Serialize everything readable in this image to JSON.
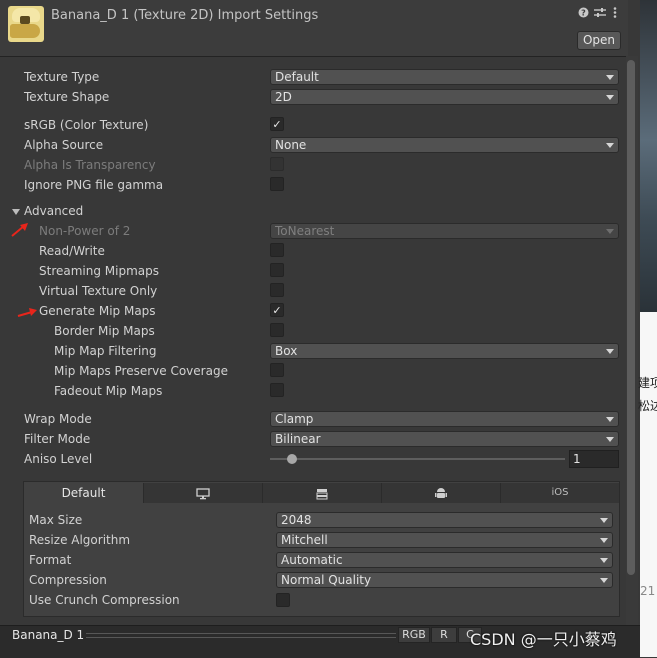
{
  "header": {
    "title": "Banana_D 1 (Texture 2D) Import Settings",
    "icons": [
      "help-icon",
      "sliders-icon",
      "more-icon"
    ],
    "open_label": "Open"
  },
  "settings": {
    "texture_type": {
      "label": "Texture Type",
      "value": "Default"
    },
    "texture_shape": {
      "label": "Texture Shape",
      "value": "2D"
    },
    "srgb": {
      "label": "sRGB (Color Texture)",
      "checked": true
    },
    "alpha_source": {
      "label": "Alpha Source",
      "value": "None"
    },
    "alpha_is_transparency": {
      "label": "Alpha Is Transparency",
      "checked": false
    },
    "ignore_png_gamma": {
      "label": "Ignore PNG file gamma",
      "checked": false
    },
    "advanced": {
      "label": "Advanced"
    },
    "non_power_of_2": {
      "label": "Non-Power of 2",
      "value": "ToNearest"
    },
    "read_write": {
      "label": "Read/Write",
      "checked": false
    },
    "streaming_mipmaps": {
      "label": "Streaming Mipmaps",
      "checked": false
    },
    "virtual_texture_only": {
      "label": "Virtual Texture Only",
      "checked": false
    },
    "generate_mip_maps": {
      "label": "Generate Mip Maps",
      "checked": true
    },
    "border_mip_maps": {
      "label": "Border Mip Maps",
      "checked": false
    },
    "mip_map_filtering": {
      "label": "Mip Map Filtering",
      "value": "Box"
    },
    "mip_maps_preserve_coverage": {
      "label": "Mip Maps Preserve Coverage",
      "checked": false
    },
    "fadeout_mip_maps": {
      "label": "Fadeout Mip Maps",
      "checked": false
    },
    "wrap_mode": {
      "label": "Wrap Mode",
      "value": "Clamp"
    },
    "filter_mode": {
      "label": "Filter Mode",
      "value": "Bilinear"
    },
    "aniso_level": {
      "label": "Aniso Level",
      "value": "1",
      "level": 1
    }
  },
  "platform": {
    "tabs": [
      {
        "label": "Default",
        "icon": "",
        "active": true
      },
      {
        "label": "",
        "icon": "monitor-icon",
        "active": false
      },
      {
        "label": "",
        "icon": "server-icon",
        "active": false
      },
      {
        "label": "",
        "icon": "android-icon",
        "active": false
      },
      {
        "label": "iOS",
        "icon": "",
        "active": false
      }
    ],
    "max_size": {
      "label": "Max Size",
      "value": "2048"
    },
    "resize_algorithm": {
      "label": "Resize Algorithm",
      "value": "Mitchell"
    },
    "format": {
      "label": "Format",
      "value": "Automatic"
    },
    "compression": {
      "label": "Compression",
      "value": "Normal Quality"
    },
    "use_crunch": {
      "label": "Use Crunch Compression",
      "checked": false
    }
  },
  "preview": {
    "name": "Banana_D 1",
    "rgb_label": "RGB",
    "r_label": "R",
    "c_label": "C"
  },
  "background_window": {
    "text1": "建项",
    "text2": "松达",
    "text3": "21"
  },
  "watermark": "CSDN @一只小蔡鸡",
  "colors": {
    "panel_bg": "#383838",
    "annotation_arrow": "#e8251b"
  }
}
